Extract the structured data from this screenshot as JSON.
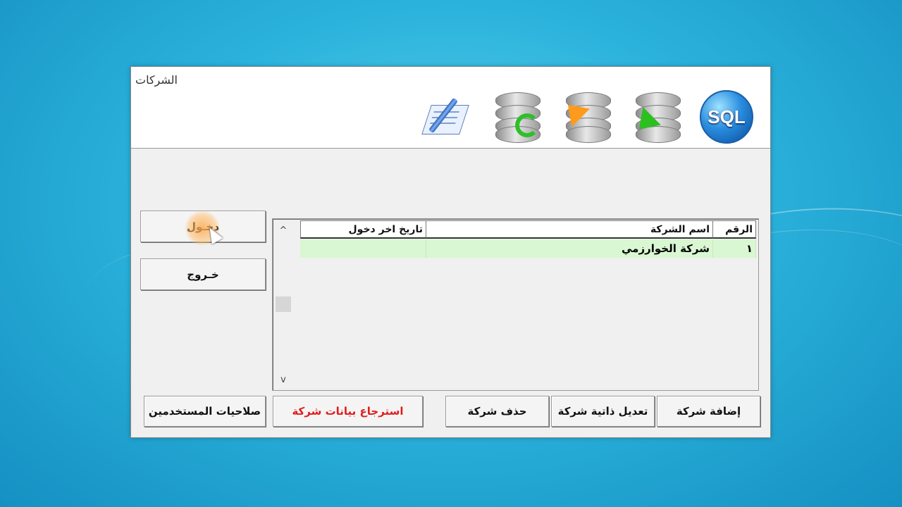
{
  "window": {
    "title": "الشركات"
  },
  "toolbar": {
    "icons": [
      "sql-icon",
      "database-import-icon",
      "database-export-icon",
      "database-refresh-icon",
      "edit-document-icon"
    ],
    "sql_label": "SQL"
  },
  "buttons": {
    "login": "دخـول",
    "exit": "خـروج",
    "add_company": "إضافة شركة",
    "edit_company": "تعديل ذاتية شركة",
    "delete_company": "حذف شركة",
    "restore_company": "استرجاع بيانات شركة",
    "user_permissions": "صلاحيات المستخدمين"
  },
  "grid": {
    "columns": [
      "الرقم",
      "اسم الشركة",
      "تاريخ اخر دخول"
    ],
    "rows": [
      {
        "number": "١",
        "name": "شركة الخوارزمي",
        "last_login": ""
      }
    ]
  },
  "colors": {
    "restore_text": "#e21c1c",
    "row_highlight": "#d9f7d2"
  }
}
